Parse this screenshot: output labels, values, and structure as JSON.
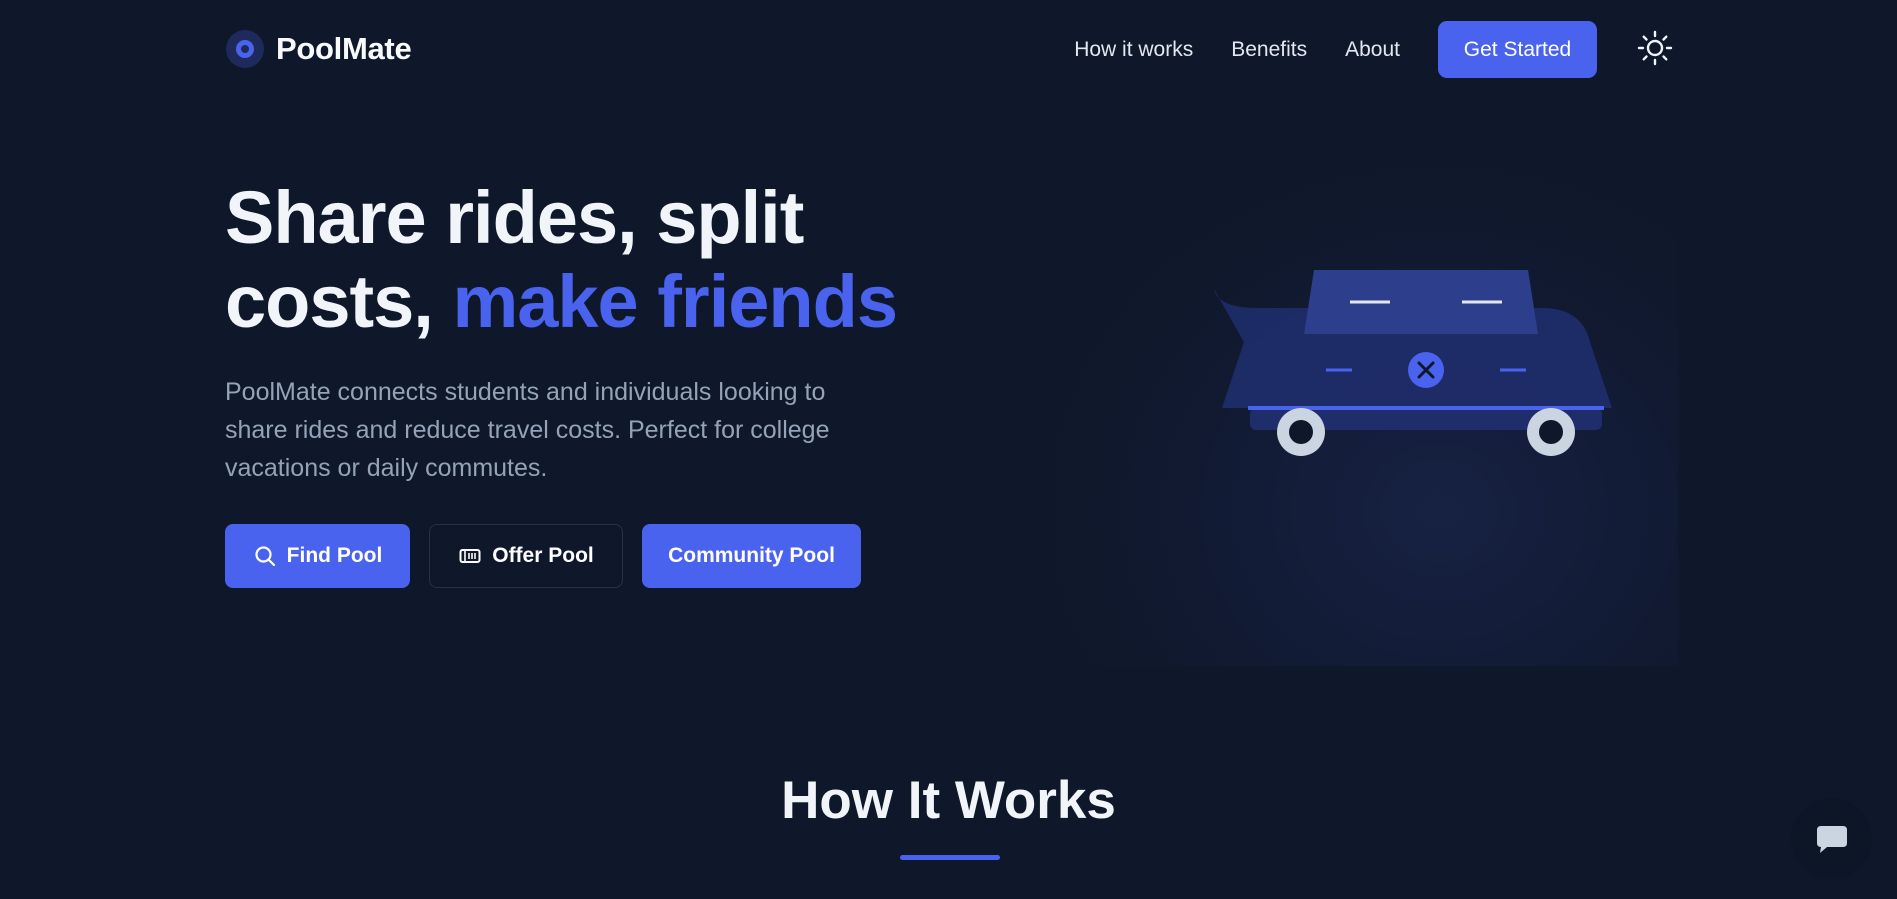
{
  "nav": {
    "brand": "PoolMate",
    "links": [
      "How it works",
      "Benefits",
      "About"
    ],
    "cta_label": "Get Started",
    "theme_icon": "sun-icon"
  },
  "hero": {
    "title_part1": "Share rides, split costs, ",
    "title_accent": "make friends",
    "subtitle": "PoolMate connects students and individuals looking to share rides and reduce travel costs. Perfect for college vacations or daily commutes.",
    "buttons": [
      {
        "label": "Find Pool",
        "icon": "search-icon"
      },
      {
        "label": "Offer Pool",
        "icon": "ticket-icon"
      },
      {
        "label": "Community Pool",
        "icon": ""
      }
    ]
  },
  "illustration": {
    "icon": "car-illustration"
  },
  "section": {
    "title": "How It Works"
  },
  "chat": {
    "icon": "chat-icon"
  },
  "colors": {
    "background": "#0f172a",
    "accent": "#4a63ee",
    "muted_text": "#94a3b8"
  }
}
